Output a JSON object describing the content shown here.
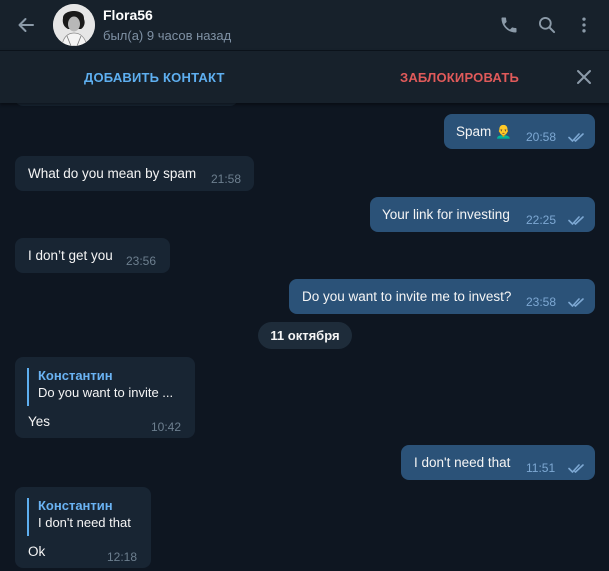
{
  "header": {
    "contact_name": "Flora56",
    "last_seen": "был(а) 9 часов назад",
    "icons": [
      "arrow-left-icon",
      "phone-icon",
      "search-icon",
      "more-vertical-icon"
    ]
  },
  "action_bar": {
    "add_contact": "ДОБАВИТЬ КОНТАКТ",
    "block": "ЗАБЛОКИРОВАТЬ",
    "colors": {
      "add": "#5eaff0",
      "block": "#e05a5a"
    }
  },
  "messages": [
    {
      "direction": "out",
      "text": "Spam 👨‍🦲",
      "time": "20:58",
      "read": true
    },
    {
      "direction": "in",
      "text": "What do you mean by spam",
      "time": "21:58"
    },
    {
      "direction": "out",
      "text": "Your link for investing",
      "time": "22:25",
      "read": true
    },
    {
      "direction": "in",
      "text": "I don’t get you",
      "time": "23:56"
    },
    {
      "direction": "out",
      "text": "Do you want to invite me to invest?",
      "time": "23:58",
      "read": true
    },
    {
      "direction": "in",
      "reply_name": "Константин",
      "reply_text": "Do you want to invite ...",
      "text": "Yes",
      "time": "10:42"
    },
    {
      "direction": "out",
      "text": "I don't need that",
      "time": "11:51",
      "read": true
    },
    {
      "direction": "in",
      "reply_name": "Константин",
      "reply_text": "I don't need that",
      "text": "Ok",
      "time": "12:18"
    }
  ],
  "date_separator": "11 октября",
  "colors": {
    "background": "#0e1621",
    "header": "#17212b",
    "incoming_bubble": "#182533",
    "outgoing_bubble": "#2b5278",
    "accent": "#5eaff0"
  }
}
